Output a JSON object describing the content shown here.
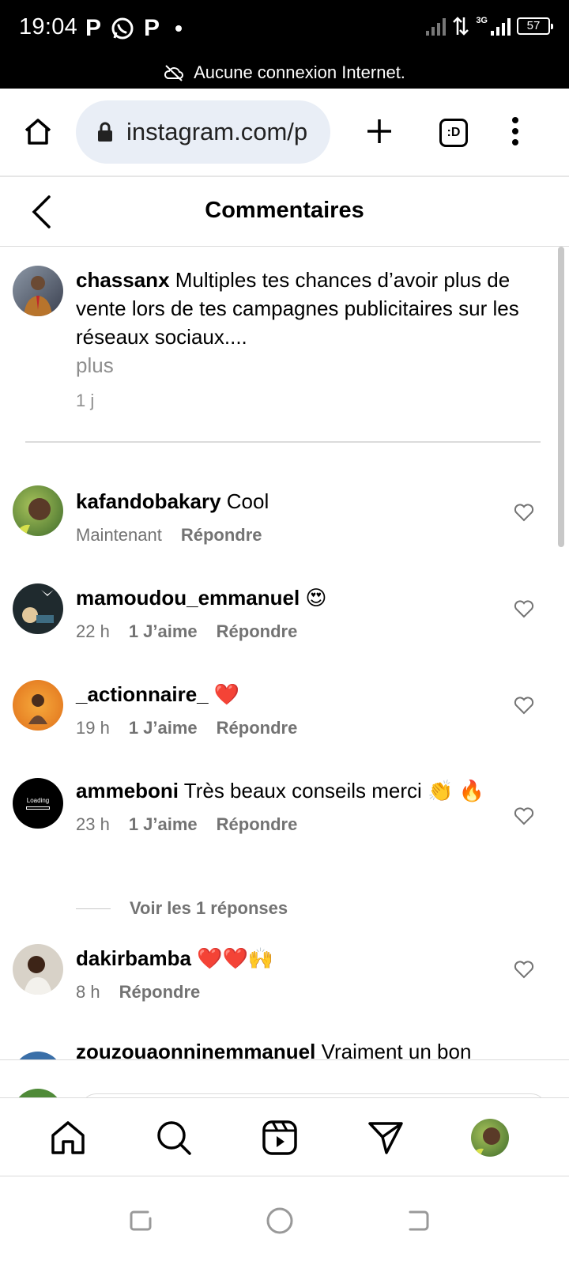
{
  "status_bar": {
    "time": "19:04",
    "left_icons": [
      "p-icon",
      "whatsapp-icon",
      "p-icon"
    ],
    "network": "3G",
    "battery": "57"
  },
  "offline_banner": {
    "icon": "cloud-off-icon",
    "text": "Aucune connexion Internet."
  },
  "browser": {
    "url": "instagram.com/p",
    "tabs_label": ":D"
  },
  "header": {
    "title": "Commentaires"
  },
  "caption": {
    "username": "chassanx",
    "text": "Multiples tes chances d’avoir plus de vente lors de tes campagnes publicitaires sur les réseaux sociaux....",
    "more": "plus",
    "time": "1 j"
  },
  "comments": [
    {
      "username": "kafandobakary",
      "text": "Cool",
      "time": "Maintenant",
      "likes": "",
      "reply": "Répondre",
      "avatar_color": "#5d8a3a"
    },
    {
      "username": "mamoudou_emmanuel",
      "text": "😍",
      "time": "22 h",
      "likes": "1 J’aime",
      "reply": "Répondre",
      "avatar_color": "#1f2a2e"
    },
    {
      "username": "_actionnaire_",
      "text": "❤️",
      "time": "19 h",
      "likes": "1 J’aime",
      "reply": "Répondre",
      "avatar_color": "#e98b2a"
    },
    {
      "username": "ammeboni",
      "text": "Très beaux conseils merci 👏 🔥",
      "time": "23 h",
      "likes": "1 J’aime",
      "reply": "Répondre",
      "avatar_color": "#000000",
      "avatar_text": "Loading"
    },
    {
      "username": "dakirbamba",
      "text": "❤️❤️🙌",
      "time": "8 h",
      "likes": "",
      "reply": "Répondre",
      "avatar_color": "#d8d2c8"
    }
  ],
  "view_replies": "Voir les 1 réponses",
  "partial_comment": {
    "username": "zouzouaonninemmanuel",
    "text": "Vraiment un bon"
  },
  "colors": {
    "secondary_text": "#737373",
    "url_bar": "#e9eef6",
    "divider": "#dbdbdb"
  }
}
